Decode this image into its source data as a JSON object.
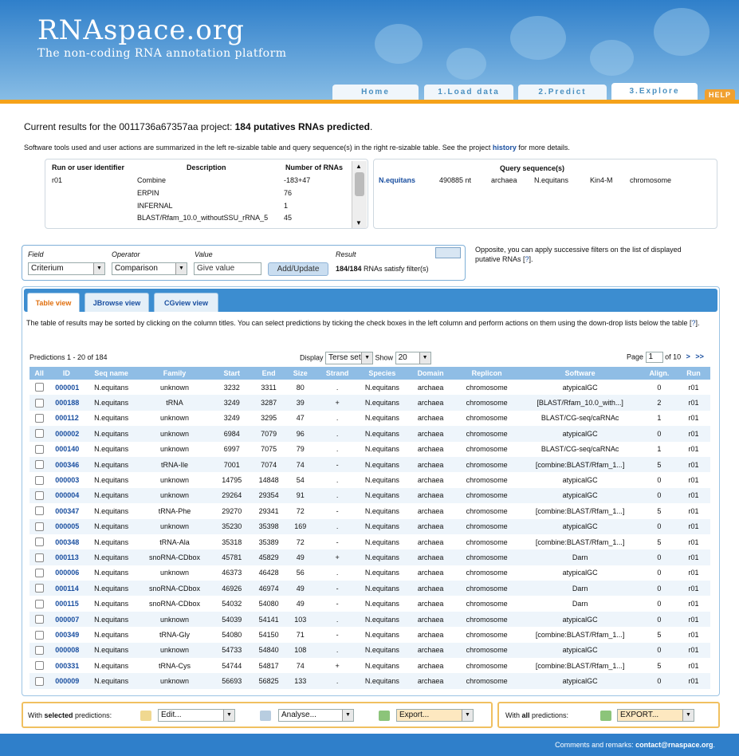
{
  "header": {
    "logo": "RNAspace.org",
    "tagline": "The non-coding RNA annotation platform",
    "tabs": [
      "Home",
      "1.Load data",
      "2.Predict",
      "3.Explore"
    ],
    "active_tab": "3.Explore",
    "help": "HELP"
  },
  "summary": {
    "prefix": "Current results for the 0011736a67357aa project: ",
    "bold": "184 putatives RNAs predicted",
    "suffix": ".",
    "info_before": "Software tools used and user actions are summarized in the left re-sizable table and query sequence(s) in the right re-sizable table. See the project ",
    "history_link": "history",
    "info_after": " for more details."
  },
  "runs_table": {
    "headers": [
      "Run or user identifier",
      "Description",
      "Number of RNAs"
    ],
    "rows": [
      [
        "r01",
        "Combine",
        "-183+47"
      ],
      [
        "",
        "ERPIN",
        "76"
      ],
      [
        "",
        "INFERNAL",
        "1"
      ],
      [
        "",
        "BLAST/Rfam_10.0_withoutSSU_rRNA_5",
        "45"
      ]
    ]
  },
  "query_table": {
    "header": "Query sequence(s)",
    "row": [
      "N.equitans",
      "490885 nt",
      "archaea",
      "N.equitans",
      "Kin4-M",
      "chromosome"
    ]
  },
  "filter": {
    "labels": [
      "Field",
      "Operator",
      "Value",
      "Result"
    ],
    "field_value": "Criterium",
    "operator_value": "Comparison",
    "value_placeholder": "Give value",
    "add_button": "Add/Update",
    "result_bold": "184/184",
    "result_text": " RNAs satisfy filter(s)"
  },
  "opposite_text": "Opposite, you can apply successive filters on the list of displayed putative RNAs [",
  "opposite_link": "?",
  "opposite_end": "].",
  "view_tabs": [
    "Table view",
    "JBrowse view",
    "CGview view"
  ],
  "active_view": "Table view",
  "table_info": "The table of results may be sorted by clicking on the column titles. You can select predictions by ticking the check boxes in the left column and perform actions on them using the down-drop lists below the table [",
  "table_info_link": "?",
  "table_info_end": "].",
  "pagination": {
    "predictions": "Predictions 1 - 20 of 184",
    "display_label": "Display",
    "display_value": "Terse set",
    "show_label": "Show",
    "show_value": "20",
    "page_label": "Page",
    "page_value": "1",
    "of_label": "of 10",
    "next": ">",
    "last": ">>"
  },
  "columns": [
    "All",
    "ID",
    "Seq name",
    "Family",
    "Start",
    "End",
    "Size",
    "Strand",
    "Species",
    "Domain",
    "Replicon",
    "Software",
    "Align.",
    "Run"
  ],
  "rows": [
    [
      "000001",
      "N.equitans",
      "unknown",
      "3232",
      "3311",
      "80",
      ".",
      "N.equitans",
      "archaea",
      "chromosome",
      "atypicalGC",
      "0",
      "r01"
    ],
    [
      "000188",
      "N.equitans",
      "tRNA",
      "3249",
      "3287",
      "39",
      "+",
      "N.equitans",
      "archaea",
      "chromosome",
      "[BLAST/Rfam_10.0_with...]",
      "2",
      "r01"
    ],
    [
      "000112",
      "N.equitans",
      "unknown",
      "3249",
      "3295",
      "47",
      ".",
      "N.equitans",
      "archaea",
      "chromosome",
      "BLAST/CG-seq/caRNAc",
      "1",
      "r01"
    ],
    [
      "000002",
      "N.equitans",
      "unknown",
      "6984",
      "7079",
      "96",
      ".",
      "N.equitans",
      "archaea",
      "chromosome",
      "atypicalGC",
      "0",
      "r01"
    ],
    [
      "000140",
      "N.equitans",
      "unknown",
      "6997",
      "7075",
      "79",
      ".",
      "N.equitans",
      "archaea",
      "chromosome",
      "BLAST/CG-seq/caRNAc",
      "1",
      "r01"
    ],
    [
      "000346",
      "N.equitans",
      "tRNA-Ile",
      "7001",
      "7074",
      "74",
      "-",
      "N.equitans",
      "archaea",
      "chromosome",
      "[combine:BLAST/Rfam_1...]",
      "5",
      "r01"
    ],
    [
      "000003",
      "N.equitans",
      "unknown",
      "14795",
      "14848",
      "54",
      ".",
      "N.equitans",
      "archaea",
      "chromosome",
      "atypicalGC",
      "0",
      "r01"
    ],
    [
      "000004",
      "N.equitans",
      "unknown",
      "29264",
      "29354",
      "91",
      ".",
      "N.equitans",
      "archaea",
      "chromosome",
      "atypicalGC",
      "0",
      "r01"
    ],
    [
      "000347",
      "N.equitans",
      "tRNA-Phe",
      "29270",
      "29341",
      "72",
      "-",
      "N.equitans",
      "archaea",
      "chromosome",
      "[combine:BLAST/Rfam_1...]",
      "5",
      "r01"
    ],
    [
      "000005",
      "N.equitans",
      "unknown",
      "35230",
      "35398",
      "169",
      ".",
      "N.equitans",
      "archaea",
      "chromosome",
      "atypicalGC",
      "0",
      "r01"
    ],
    [
      "000348",
      "N.equitans",
      "tRNA-Ala",
      "35318",
      "35389",
      "72",
      "-",
      "N.equitans",
      "archaea",
      "chromosome",
      "[combine:BLAST/Rfam_1...]",
      "5",
      "r01"
    ],
    [
      "000113",
      "N.equitans",
      "snoRNA-CDbox",
      "45781",
      "45829",
      "49",
      "+",
      "N.equitans",
      "archaea",
      "chromosome",
      "Darn",
      "0",
      "r01"
    ],
    [
      "000006",
      "N.equitans",
      "unknown",
      "46373",
      "46428",
      "56",
      ".",
      "N.equitans",
      "archaea",
      "chromosome",
      "atypicalGC",
      "0",
      "r01"
    ],
    [
      "000114",
      "N.equitans",
      "snoRNA-CDbox",
      "46926",
      "46974",
      "49",
      "-",
      "N.equitans",
      "archaea",
      "chromosome",
      "Darn",
      "0",
      "r01"
    ],
    [
      "000115",
      "N.equitans",
      "snoRNA-CDbox",
      "54032",
      "54080",
      "49",
      "-",
      "N.equitans",
      "archaea",
      "chromosome",
      "Darn",
      "0",
      "r01"
    ],
    [
      "000007",
      "N.equitans",
      "unknown",
      "54039",
      "54141",
      "103",
      ".",
      "N.equitans",
      "archaea",
      "chromosome",
      "atypicalGC",
      "0",
      "r01"
    ],
    [
      "000349",
      "N.equitans",
      "tRNA-Gly",
      "54080",
      "54150",
      "71",
      "-",
      "N.equitans",
      "archaea",
      "chromosome",
      "[combine:BLAST/Rfam_1...]",
      "5",
      "r01"
    ],
    [
      "000008",
      "N.equitans",
      "unknown",
      "54733",
      "54840",
      "108",
      ".",
      "N.equitans",
      "archaea",
      "chromosome",
      "atypicalGC",
      "0",
      "r01"
    ],
    [
      "000331",
      "N.equitans",
      "tRNA-Cys",
      "54744",
      "54817",
      "74",
      "+",
      "N.equitans",
      "archaea",
      "chromosome",
      "[combine:BLAST/Rfam_1...]",
      "5",
      "r01"
    ],
    [
      "000009",
      "N.equitans",
      "unknown",
      "56693",
      "56825",
      "133",
      ".",
      "N.equitans",
      "archaea",
      "chromosome",
      "atypicalGC",
      "0",
      "r01"
    ]
  ],
  "actions": {
    "selected_prefix": "With ",
    "selected_bold": "selected",
    "selected_suffix": " predictions:",
    "edit": "Edit...",
    "analyse": "Analyse...",
    "export": "Export...",
    "all_prefix": "With ",
    "all_bold": "all",
    "all_suffix": " predictions:",
    "export_all": "EXPORT..."
  },
  "footer": {
    "text": "Comments and remarks: ",
    "email": "contact@rnaspace.org",
    "end": "."
  },
  "colors": {
    "brand_blue": "#2f7fca",
    "accent_orange": "#f5a21a",
    "link": "#1a4fa0"
  }
}
